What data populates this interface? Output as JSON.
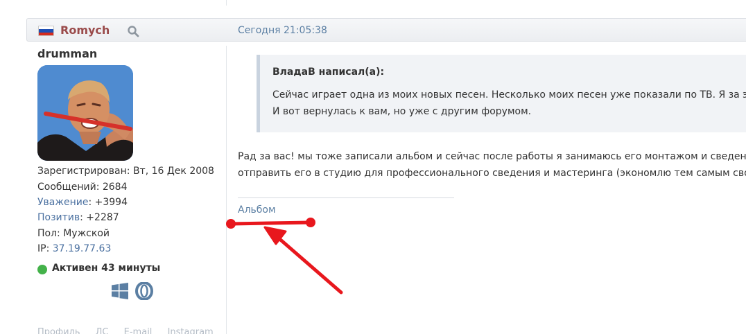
{
  "header": {
    "author": "Romych",
    "time": "Сегодня 21:05:38"
  },
  "user": {
    "username": "drumman",
    "registered": "Зарегистрирован: Вт, 16 Дек 2008",
    "messages": "Сообщений: 2684",
    "respect_label": "Уважение",
    "respect_value": ": +3994",
    "positive_label": "Позитив",
    "positive_value": ": +2287",
    "gender": "Пол: Мужской",
    "ip_label": "IP: ",
    "ip_value": "37.19.77.63",
    "status": "Активен 43 минуты",
    "status_color": "#44b24a",
    "os_icons": [
      "windows-icon",
      "opera-icon"
    ],
    "bottom_links": [
      "Профиль",
      "ЛС",
      "E-mail",
      "Instagram"
    ]
  },
  "quote": {
    "author": "ВладаВ написал(а):",
    "line1": "Сейчас играет одна из моих новых песен. Несколько моих песен уже показали по ТВ. Я за э",
    "line2": "И вот вернулась к вам, но уже с другим форумом."
  },
  "post": {
    "line1": "Рад за вас! мы тоже записали альбом и сейчас после работы я занимаюсь его монтажом и сведени",
    "line2": "отправить его в студию для профессионального сведения и мастеринга (экономлю тем самым свои",
    "signature_link": "Альбом"
  },
  "colors": {
    "author": "#9a4b4b",
    "link": "#5b7fa3",
    "annotation": "#e8171d"
  }
}
